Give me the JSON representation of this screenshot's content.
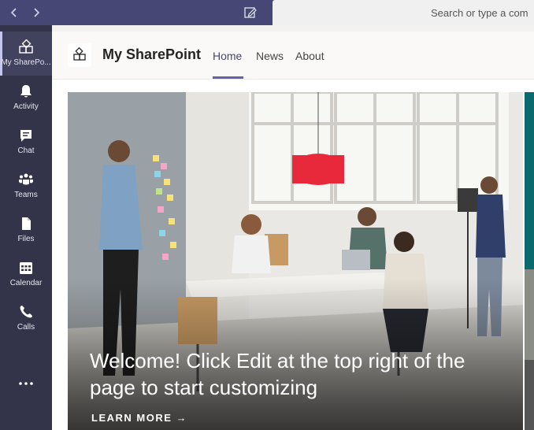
{
  "topbar": {
    "search_placeholder": "Search or type a com",
    "back_icon": "chevron-left-icon",
    "forward_icon": "chevron-right-icon",
    "compose_icon": "compose-icon"
  },
  "rail": {
    "items": [
      {
        "label": "My SharePo...",
        "icon": "sharepoint-icon",
        "active": true
      },
      {
        "label": "Activity",
        "icon": "bell-icon"
      },
      {
        "label": "Chat",
        "icon": "chat-icon"
      },
      {
        "label": "Teams",
        "icon": "teams-icon"
      },
      {
        "label": "Files",
        "icon": "file-icon"
      },
      {
        "label": "Calendar",
        "icon": "calendar-icon"
      },
      {
        "label": "Calls",
        "icon": "phone-icon"
      }
    ],
    "more_label": "···"
  },
  "header": {
    "site_title": "My SharePoint",
    "tabs": [
      {
        "label": "Home",
        "active": true
      },
      {
        "label": "News"
      },
      {
        "label": "About"
      }
    ]
  },
  "hero": {
    "title": "Welcome! Click Edit at the top right of the page to start customizing",
    "link_label": "LEARN MORE →"
  },
  "colors": {
    "accent": "#6264a7",
    "topbar": "#464775",
    "rail": "#33344a"
  }
}
